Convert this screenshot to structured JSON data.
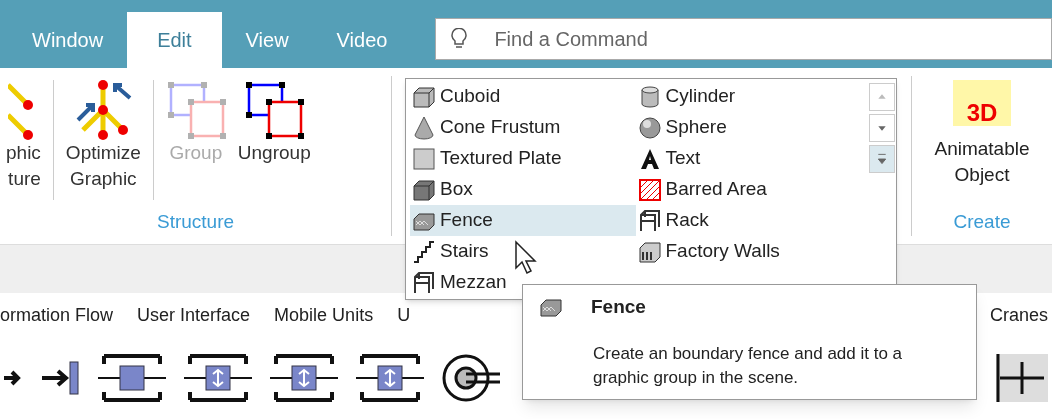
{
  "tabs": [
    {
      "label": "Window",
      "selected": false
    },
    {
      "label": "Edit",
      "selected": true
    },
    {
      "label": "View",
      "selected": false
    },
    {
      "label": "Video",
      "selected": false
    }
  ],
  "search": {
    "placeholder": "Find a Command"
  },
  "structure_group": {
    "label": "Structure",
    "buttons": [
      {
        "kind": "graphic",
        "lines": [
          "phic",
          "ture"
        ],
        "disabled": false
      },
      {
        "kind": "optimize",
        "lines": [
          "Optimize",
          "Graphic"
        ],
        "disabled": false
      },
      {
        "kind": "group",
        "lines": [
          "Group"
        ],
        "disabled": true
      },
      {
        "kind": "ungroup",
        "lines": [
          "Ungroup"
        ],
        "disabled": false
      }
    ]
  },
  "gallery": {
    "items": [
      {
        "kind": "cuboid",
        "label": "Cuboid",
        "selected": false
      },
      {
        "kind": "cylinder",
        "label": "Cylinder",
        "selected": false
      },
      {
        "kind": "cone",
        "label": "Cone Frustum",
        "selected": false
      },
      {
        "kind": "sphere",
        "label": "Sphere",
        "selected": false
      },
      {
        "kind": "plate",
        "label": "Textured Plate",
        "selected": false
      },
      {
        "kind": "text",
        "label": "Text",
        "selected": false
      },
      {
        "kind": "box",
        "label": "Box",
        "selected": false
      },
      {
        "kind": "barred",
        "label": "Barred Area",
        "selected": false
      },
      {
        "kind": "fence",
        "label": "Fence",
        "selected": true
      },
      {
        "kind": "rack",
        "label": "Rack",
        "selected": false
      },
      {
        "kind": "stairs",
        "label": "Stairs",
        "selected": false
      },
      {
        "kind": "walls",
        "label": "Factory Walls",
        "selected": false
      },
      {
        "kind": "rack",
        "label": "Mezzan",
        "selected": false
      }
    ]
  },
  "create_group": {
    "label": "Create",
    "button": [
      "Animatable",
      "Object"
    ],
    "icon_text": "3D"
  },
  "library_tabs": [
    "ormation Flow",
    "User Interface",
    "Mobile Units",
    "U",
    "Cranes"
  ],
  "tooltip": {
    "title": "Fence",
    "text": "Create an boundary fence and add it to a graphic group in the scene."
  }
}
